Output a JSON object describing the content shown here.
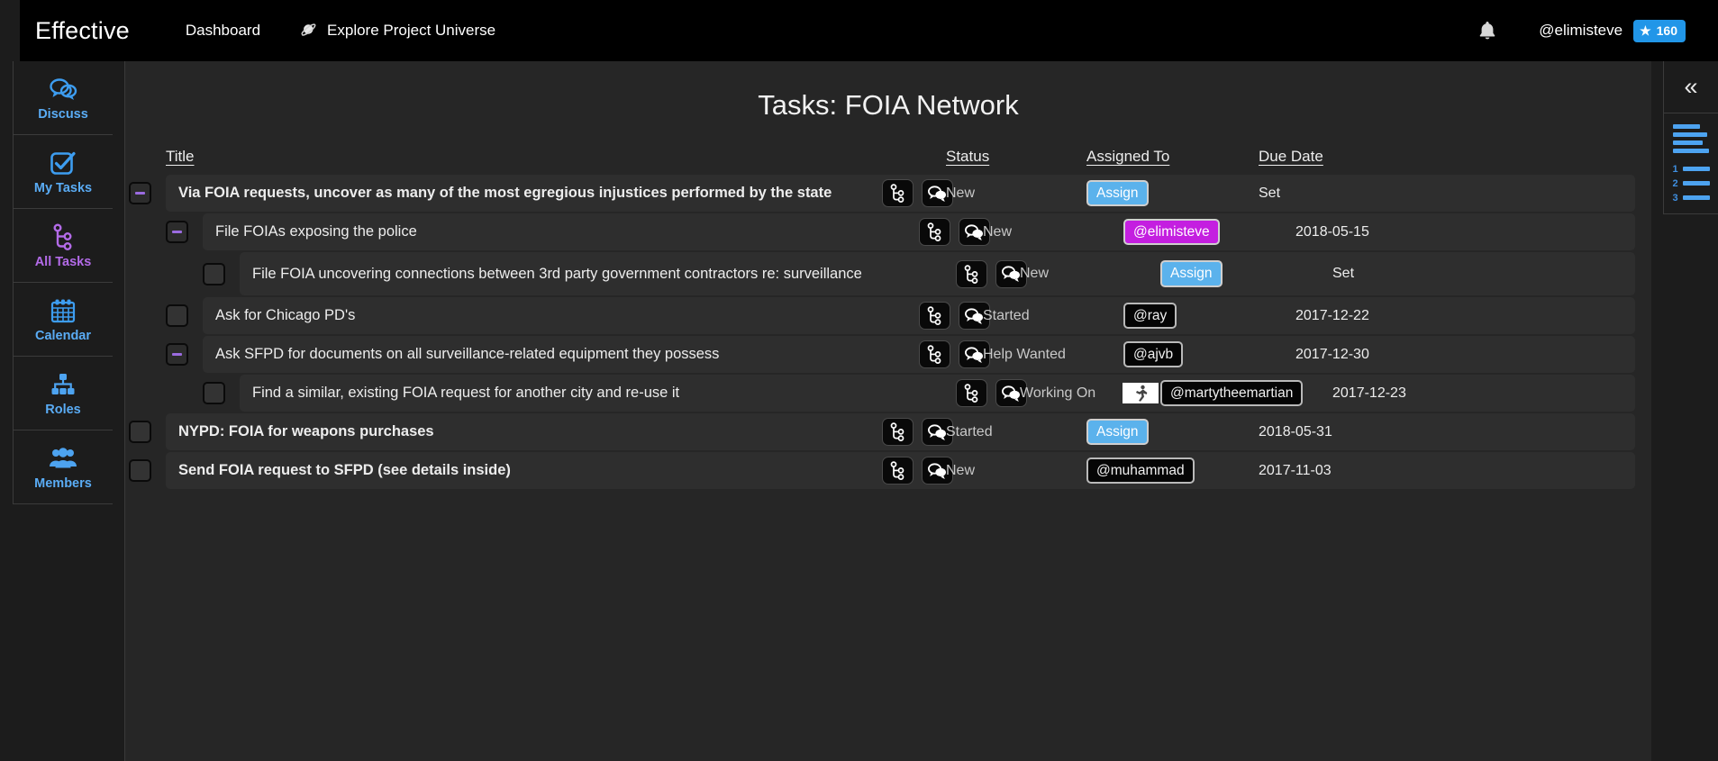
{
  "topbar": {
    "brand": "Effective",
    "nav": [
      {
        "label": "Dashboard",
        "icon": ""
      },
      {
        "label": "Explore Project Universe",
        "icon": "planet-icon"
      }
    ],
    "bell_icon": "bell-icon",
    "username": "@elimisteve",
    "score_star": "★",
    "score": "160"
  },
  "sidebar": {
    "items": [
      {
        "label": "Discuss",
        "icon": "chat-bubbles-icon",
        "active": false
      },
      {
        "label": "My Tasks",
        "icon": "checkbox-check-icon",
        "active": false
      },
      {
        "label": "All Tasks",
        "icon": "branch-tree-icon",
        "active": true
      },
      {
        "label": "Calendar",
        "icon": "calendar-icon",
        "active": false
      },
      {
        "label": "Roles",
        "icon": "org-chart-icon",
        "active": false
      },
      {
        "label": "Members",
        "icon": "people-group-icon",
        "active": false
      }
    ]
  },
  "main": {
    "title": "Tasks: FOIA Network",
    "columns": {
      "title": "Title",
      "status": "Status",
      "assigned_to": "Assigned To",
      "due_date": "Due Date"
    },
    "rows": [
      {
        "title": "Via FOIA requests, uncover as many of the most egregious injustices performed by the state",
        "level": 0,
        "control": "toggle-minus",
        "bold": true,
        "tall": false,
        "status": "New",
        "status_img": "",
        "assignee": "Assign",
        "assignee_type": "assign",
        "due": "Set"
      },
      {
        "title": "File FOIAs exposing the police",
        "level": 1,
        "control": "toggle-minus",
        "bold": false,
        "tall": false,
        "status": "New",
        "status_img": "",
        "assignee": "@elimisteve",
        "assignee_type": "self",
        "due": "2018-05-15"
      },
      {
        "title": "File FOIA uncovering connections between 3rd party government contractors re: surveillance",
        "level": 2,
        "control": "checkbox",
        "bold": false,
        "tall": true,
        "status": "New",
        "status_img": "",
        "assignee": "Assign",
        "assignee_type": "assign",
        "due": "Set"
      },
      {
        "title": "Ask for Chicago PD's",
        "level": 1,
        "control": "checkbox",
        "bold": false,
        "tall": false,
        "status": "Started",
        "status_img": "",
        "assignee": "@ray",
        "assignee_type": "user",
        "due": "2017-12-22"
      },
      {
        "title": "Ask SFPD for documents on all surveillance-related equipment they possess",
        "level": 1,
        "control": "toggle-minus",
        "bold": false,
        "tall": false,
        "status": "Help Wanted",
        "status_img": "",
        "assignee": "@ajvb",
        "assignee_type": "user",
        "due": "2017-12-30"
      },
      {
        "title": "Find a similar, existing FOIA request for another city and re-use it",
        "level": 2,
        "control": "checkbox",
        "bold": false,
        "tall": false,
        "status": "Working On",
        "status_img": "running-person-icon",
        "assignee": "@martytheemartian",
        "assignee_type": "user",
        "due": "2017-12-23"
      },
      {
        "title": "NYPD: FOIA for weapons purchases",
        "level": 0,
        "control": "checkbox",
        "bold": true,
        "tall": false,
        "status": "Started",
        "status_img": "",
        "assignee": "Assign",
        "assignee_type": "assign",
        "due": "2018-05-31"
      },
      {
        "title": "Send FOIA request to SFPD (see details inside)",
        "level": 0,
        "control": "checkbox",
        "bold": true,
        "tall": false,
        "status": "New",
        "status_img": "",
        "assignee": "@muhammad",
        "assignee_type": "user",
        "due": "2017-11-03"
      }
    ],
    "row_icons": {
      "subtask": "branch-tree-icon",
      "discuss": "chat-bubbles-icon"
    }
  },
  "rightbar": {
    "collapse_icon": "chevron-double-left-icon",
    "collapse_glyph": "«",
    "list_view_icon": "bullet-list-icon",
    "numbered_view_icon": "numbered-list-icon",
    "numbers": [
      "1",
      "2",
      "3"
    ]
  },
  "colors": {
    "accent_blue": "#5bb2ec",
    "accent_purple": "#c41fe0",
    "active_nav": "#b36be8",
    "nav_blue": "#5aacf5",
    "panel_bg": "#262626",
    "row_bg": "#2e2e2e",
    "sidebar_bg": "#1c1c1c"
  }
}
